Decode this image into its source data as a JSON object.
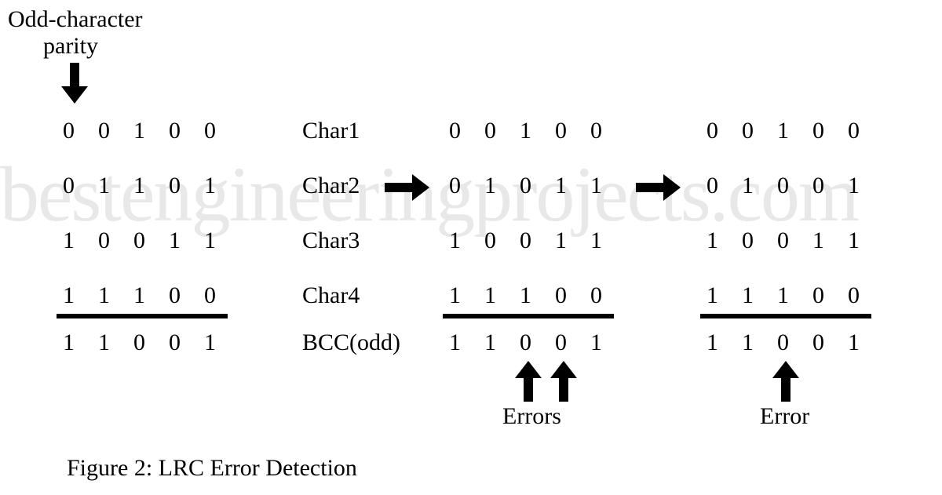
{
  "header": {
    "parity_label_line1": "Odd-character",
    "parity_label_line2": "parity"
  },
  "watermark": "bestengineeringprojects.com",
  "row_labels": [
    "Char1",
    "Char2",
    "Char3",
    "Char4",
    "BCC(odd)"
  ],
  "blocks": [
    {
      "rows": [
        [
          "0",
          "0",
          "1",
          "0",
          "0"
        ],
        [
          "0",
          "1",
          "1",
          "0",
          "1"
        ],
        [
          "1",
          "0",
          "0",
          "1",
          "1"
        ],
        [
          "1",
          "1",
          "1",
          "0",
          "0"
        ],
        [
          "1",
          "1",
          "0",
          "0",
          "1"
        ]
      ]
    },
    {
      "rows": [
        [
          "0",
          "0",
          "1",
          "0",
          "0"
        ],
        [
          "0",
          "1",
          "0",
          "1",
          "1"
        ],
        [
          "1",
          "0",
          "0",
          "1",
          "1"
        ],
        [
          "1",
          "1",
          "1",
          "0",
          "0"
        ],
        [
          "1",
          "1",
          "0",
          "0",
          "1"
        ]
      ]
    },
    {
      "rows": [
        [
          "0",
          "0",
          "1",
          "0",
          "0"
        ],
        [
          "0",
          "1",
          "0",
          "0",
          "1"
        ],
        [
          "1",
          "0",
          "0",
          "1",
          "1"
        ],
        [
          "1",
          "1",
          "1",
          "0",
          "0"
        ],
        [
          "1",
          "1",
          "0",
          "0",
          "1"
        ]
      ]
    }
  ],
  "errors": {
    "block2_label": "Errors",
    "block3_label": "Error"
  },
  "caption": "Figure 2: LRC Error Detection"
}
